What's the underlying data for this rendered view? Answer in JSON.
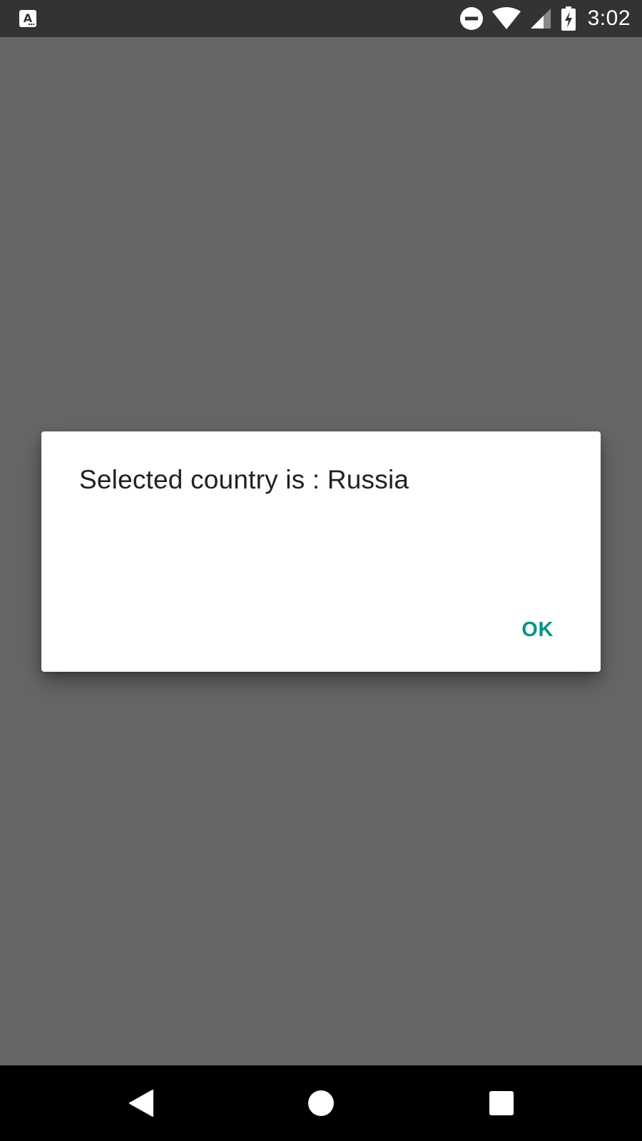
{
  "status_bar": {
    "time": "3:02",
    "icons": [
      "app-notification-icon",
      "do-not-disturb-icon",
      "wifi-icon",
      "cell-signal-icon",
      "battery-charging-icon"
    ]
  },
  "dialog": {
    "message": "Selected country is : Russia",
    "ok_label": "OK",
    "accent_color": "#009688"
  },
  "nav_bar": {
    "icons": [
      "back-icon",
      "home-icon",
      "recents-icon"
    ]
  },
  "colors": {
    "scrim": "#666666",
    "status_bar": "#333333",
    "nav_bar": "#000000",
    "dialog_bg": "#ffffff",
    "text": "#212121"
  }
}
